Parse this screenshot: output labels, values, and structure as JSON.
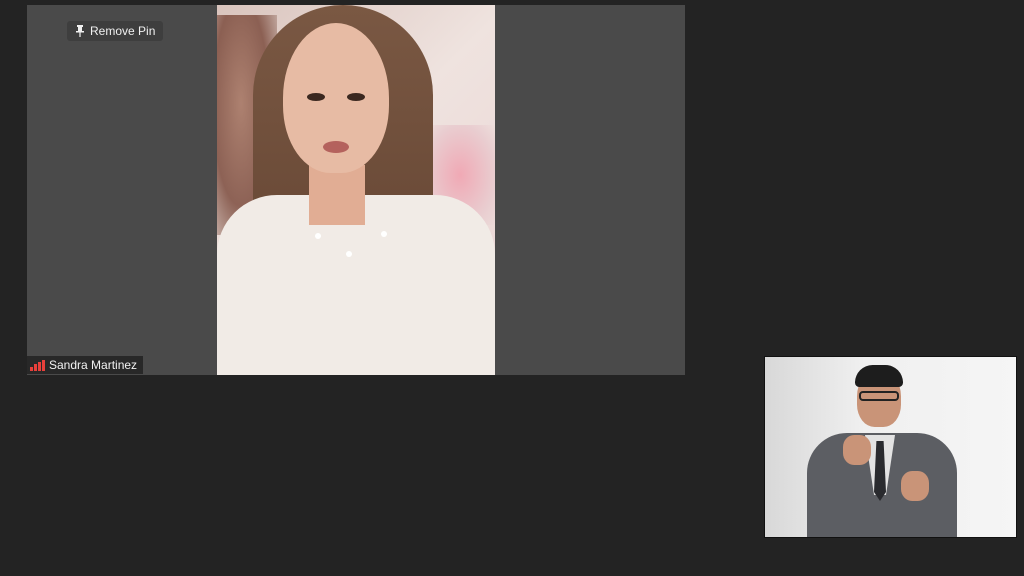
{
  "meeting": {
    "pinned_participant": {
      "name": "Sandra Martinez",
      "remove_pin_label": "Remove Pin",
      "pin_icon": "pin-icon",
      "signal_icon": "signal-strength-icon",
      "signal_color": "#e8403b"
    },
    "interpreter": {
      "role": "sign-language-interpreter"
    }
  },
  "colors": {
    "background": "#232323",
    "tile_background": "#4a4a4a"
  }
}
